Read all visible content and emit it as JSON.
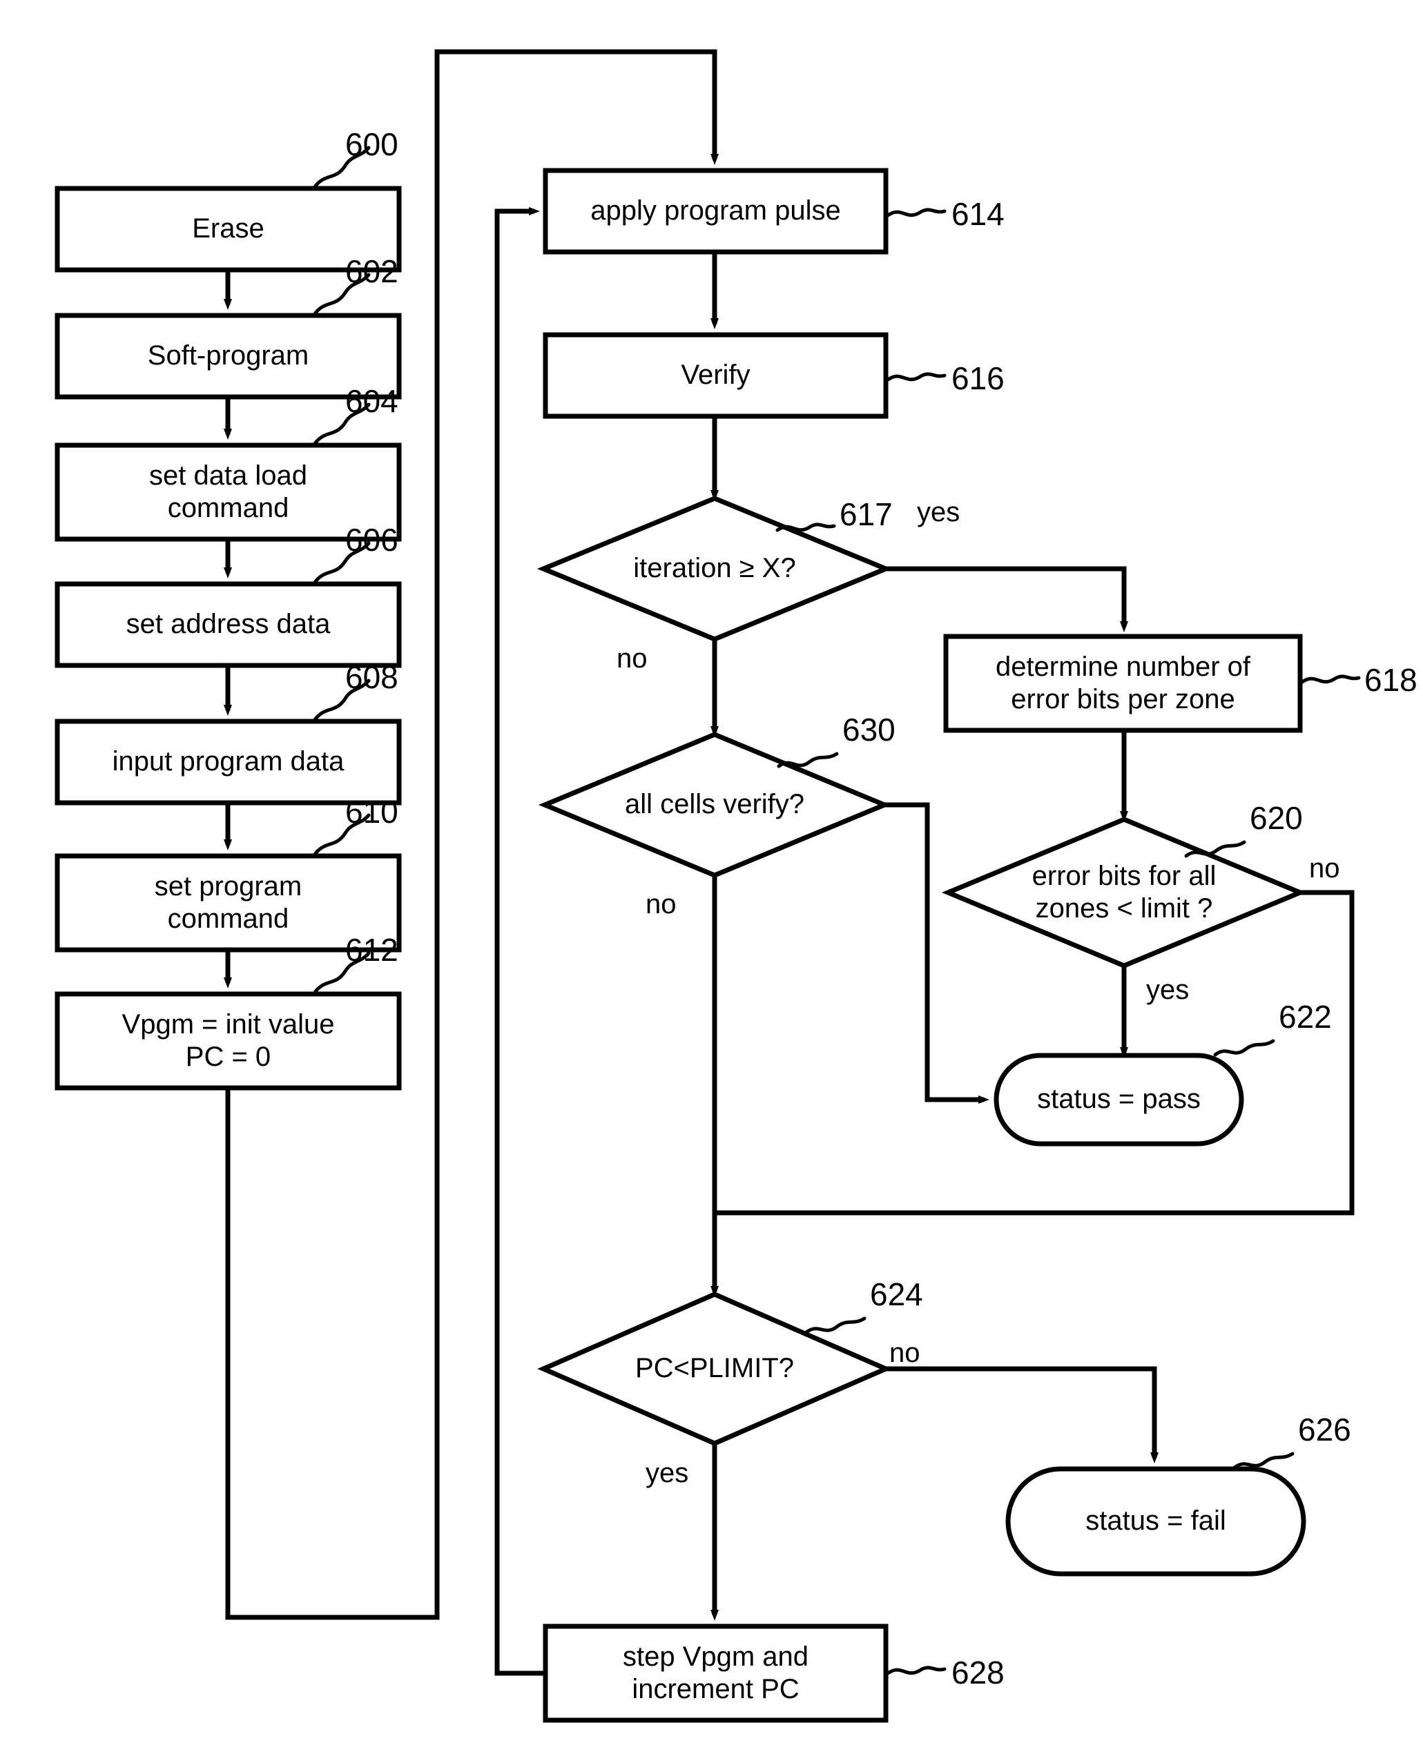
{
  "figure": {
    "type": "flowchart",
    "title": "",
    "stroke_color": "#000000",
    "background_color": "#ffffff"
  },
  "nodes": [
    {
      "id": "600",
      "ref": "600",
      "shape": "process",
      "label": "Erase"
    },
    {
      "id": "602",
      "ref": "602",
      "shape": "process",
      "label": "Soft-program"
    },
    {
      "id": "604",
      "ref": "604",
      "shape": "process",
      "label": "set data load\ncommand"
    },
    {
      "id": "606",
      "ref": "606",
      "shape": "process",
      "label": "set address data"
    },
    {
      "id": "608",
      "ref": "608",
      "shape": "process",
      "label": "input program data"
    },
    {
      "id": "610",
      "ref": "610",
      "shape": "process",
      "label": "set program\ncommand"
    },
    {
      "id": "612",
      "ref": "612",
      "shape": "process",
      "label": "Vpgm = init value\nPC = 0"
    },
    {
      "id": "614",
      "ref": "614",
      "shape": "process",
      "label": "apply program pulse"
    },
    {
      "id": "616",
      "ref": "616",
      "shape": "process",
      "label": "Verify"
    },
    {
      "id": "617",
      "ref": "617",
      "shape": "decision",
      "label": "iteration ≥ X?"
    },
    {
      "id": "630",
      "ref": "630",
      "shape": "decision",
      "label": "all cells verify?"
    },
    {
      "id": "618",
      "ref": "618",
      "shape": "process",
      "label": "determine number of\nerror bits per zone"
    },
    {
      "id": "620",
      "ref": "620",
      "shape": "decision",
      "label": "error bits for all\nzones < limit ?"
    },
    {
      "id": "622",
      "ref": "622",
      "shape": "terminator",
      "label": "status = pass"
    },
    {
      "id": "624",
      "ref": "624",
      "shape": "decision",
      "label": "PC<PLIMIT?"
    },
    {
      "id": "626",
      "ref": "626",
      "shape": "terminator",
      "label": "status = fail"
    },
    {
      "id": "628",
      "ref": "628",
      "shape": "process",
      "label": "step Vpgm and\nincrement PC"
    }
  ],
  "edge_labels": [
    {
      "id": "617-yes",
      "text": "yes"
    },
    {
      "id": "617-no",
      "text": "no"
    },
    {
      "id": "630-no",
      "text": "no"
    },
    {
      "id": "620-no",
      "text": "no"
    },
    {
      "id": "620-yes",
      "text": "yes"
    },
    {
      "id": "624-no",
      "text": "no"
    },
    {
      "id": "624-yes",
      "text": "yes"
    }
  ],
  "ref_numbers": [
    "600",
    "602",
    "604",
    "606",
    "608",
    "610",
    "612",
    "614",
    "616",
    "617",
    "618",
    "620",
    "622",
    "624",
    "626",
    "628",
    "630"
  ]
}
